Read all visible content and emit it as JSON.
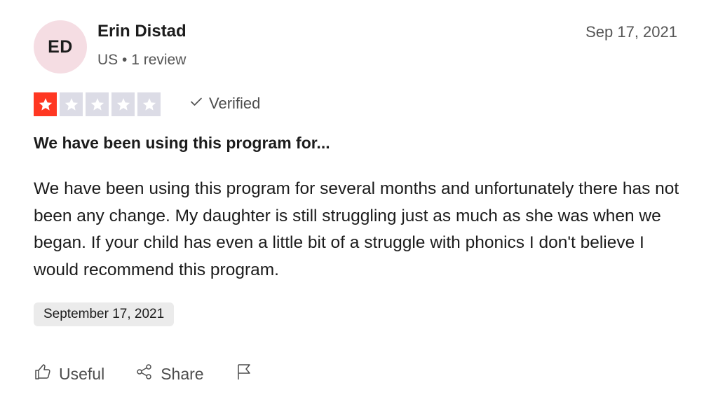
{
  "reviewer": {
    "initials": "ED",
    "name": "Erin Distad",
    "meta": "US • 1 review",
    "avatar_color": "#f5dde3"
  },
  "review": {
    "date": "Sep 17, 2021",
    "rating": 1,
    "rating_max": 5,
    "star_color": "#ff3722",
    "verified_label": "Verified",
    "title": "We have been using this program for...",
    "body": "We have been using this program for several months and unfortunately there has not been any change. My daughter is still struggling just as much as she was when we began. If your child has even a little bit of a struggle with phonics I don't believe I would recommend this program.",
    "experience_date": "September 17, 2021"
  },
  "actions": {
    "useful_label": "Useful",
    "share_label": "Share",
    "useful_icon": "thumbs-up-icon",
    "share_icon": "share-icon",
    "flag_icon": "flag-icon"
  }
}
